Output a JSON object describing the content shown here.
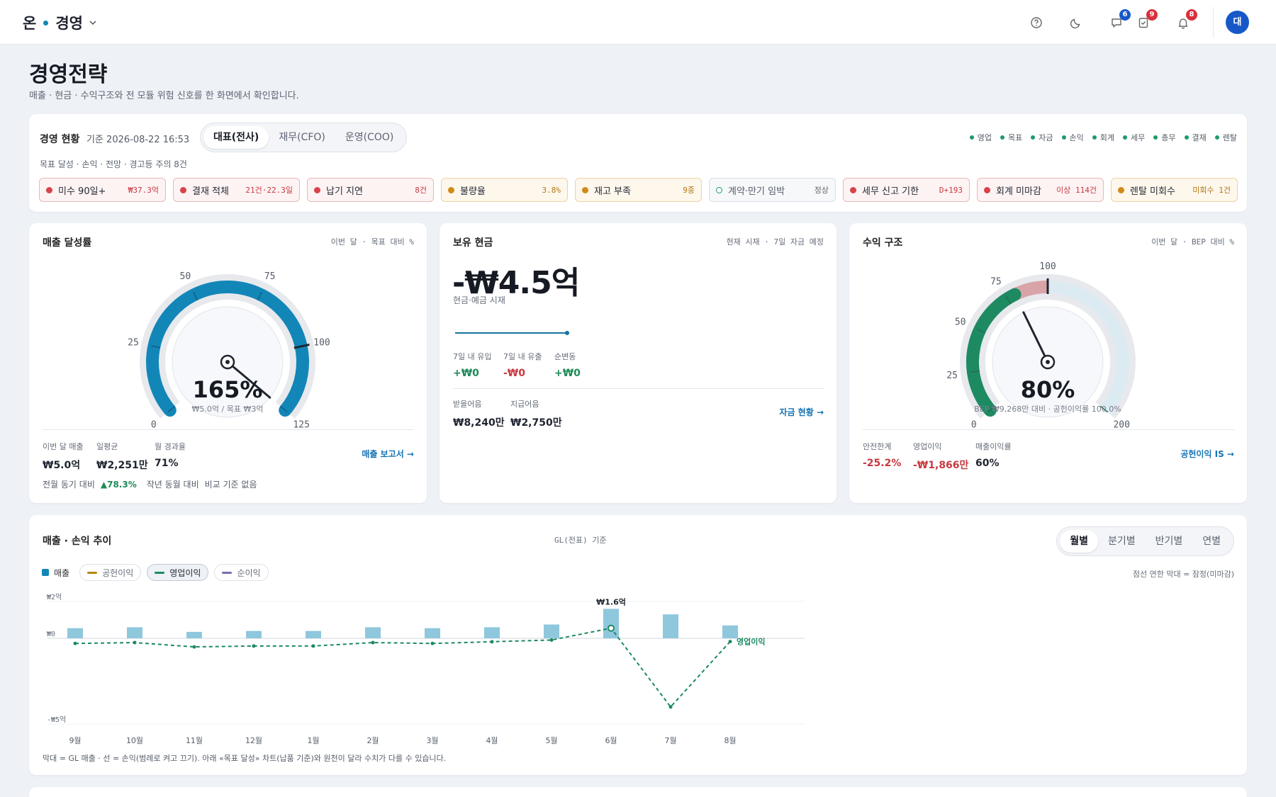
{
  "topbar": {
    "brand": "온",
    "section": "경영",
    "badges": {
      "messages": "6",
      "tasks": "9",
      "notifications": "8"
    },
    "avatar": "대"
  },
  "page": {
    "title": "경영전략",
    "subtitle": "매출 · 현금 · 수익구조와 전 모듈 위험 신호를 한 화면에서 확인합니다."
  },
  "status": {
    "title": "경영 현황",
    "timestamp": "기준 2026-08-22 16:53",
    "views": [
      "대표(전사)",
      "재무(CFO)",
      "운영(COO)"
    ],
    "active_view": "대표(전사)",
    "modules": [
      "영업",
      "목표",
      "자금",
      "손익",
      "회계",
      "세무",
      "총무",
      "결재",
      "렌탈"
    ],
    "summary": "목표 달성 · 손익 · 전망 · 경고등 주의 8건",
    "chips": [
      {
        "label": "미수 90일+",
        "value": "₩37.3억",
        "level": "red"
      },
      {
        "label": "결재 적체",
        "value": "21건·22.3일",
        "level": "red"
      },
      {
        "label": "납기 지연",
        "value": "8건",
        "level": "red"
      },
      {
        "label": "불량율",
        "value": "3.8%",
        "level": "amber"
      },
      {
        "label": "재고 부족",
        "value": "9종",
        "level": "amber"
      },
      {
        "label": "계약·만기 임박",
        "value": "정상",
        "level": "gray"
      },
      {
        "label": "세무 신고 기한",
        "value": "D+193",
        "level": "red"
      },
      {
        "label": "회계 미마감",
        "value": "이상 114건",
        "level": "red"
      },
      {
        "label": "렌탈 미회수",
        "value": "미회수 1건",
        "level": "amber"
      }
    ]
  },
  "revenue": {
    "title": "매출 달성률",
    "note": "이번 달 · 목표 대비 %",
    "gauge": {
      "value": 165,
      "display": "165%",
      "caption": "₩5.0억 / 목표 ₩3억",
      "ticks": [
        "0",
        "25",
        "50",
        "75",
        "100",
        "125"
      ],
      "max": 125,
      "target": 100
    },
    "stats": [
      {
        "label": "이번 달 매출",
        "value": "₩5.0억"
      },
      {
        "label": "일평균",
        "value": "₩2,251만"
      },
      {
        "label": "월 경과율",
        "value": "71%"
      }
    ],
    "link": "매출 보고서 →",
    "yoy": {
      "label": "전월 동기 대비",
      "value": "78.3%",
      "label2": "작년 동월 대비",
      "value2": "비교 기준 없음"
    }
  },
  "cash": {
    "title": "보유 현금",
    "note": "현재 시재 · 7일 자금 예정",
    "big": "-₩4.5억",
    "caption": "현금·예금 시재",
    "stats": [
      {
        "label": "7일 내 유입",
        "value": "+₩0",
        "color": "#1f8a57"
      },
      {
        "label": "7일 내 유출",
        "value": "-₩0",
        "color": "#c73a41"
      },
      {
        "label": "순변동",
        "value": "+₩0",
        "color": "#1f8a57"
      }
    ],
    "stats2": [
      {
        "label": "받을어음",
        "value": "₩8,240만"
      },
      {
        "label": "지급어음",
        "value": "₩2,750만"
      }
    ],
    "link": "자금 현황 →"
  },
  "profit": {
    "title": "수익 구조",
    "note": "이번 달 · BEP 대비 %",
    "gauge": {
      "value": 80,
      "display": "80%",
      "caption": "BEP ₩9,268만 대비 · 공헌이익률 100.0%",
      "ticks": [
        "0",
        "25",
        "50",
        "75",
        "100",
        "200"
      ],
      "max": 200
    },
    "stats": [
      {
        "label": "안전한계",
        "value": "-25.2%",
        "color": "#c73a41"
      },
      {
        "label": "영업이익",
        "value": "-₩1,866만",
        "color": "#c73a41"
      },
      {
        "label": "매출이익률",
        "value": "60%",
        "color": "#1f2430"
      }
    ],
    "link": "공헌이익 IS →"
  },
  "trend": {
    "title": "매출 · 손익 추이",
    "basis": "GL(전표) 기준",
    "periods": [
      "월별",
      "분기별",
      "반기별",
      "연별"
    ],
    "active_period": "월별",
    "legend": [
      "매출",
      "공헌이익",
      "영업이익",
      "순이익"
    ],
    "active_legend": "영업이익",
    "note": "점선 연한 막대 = 잠정(미마감)",
    "footnote": "막대 = GL 매출 · 선 = 손익(범례로 켜고 끄기). 아래 «목표 달성» 차트(납품 기준)와 원천이 달라 수치가 다를 수 있습니다."
  },
  "chart_data": {
    "type": "bar",
    "categories": [
      "9월",
      "10월",
      "11월",
      "12월",
      "1월",
      "2월",
      "3월",
      "4월",
      "5월",
      "6월",
      "7월",
      "8월"
    ],
    "y_tick_labels": [
      "₩2억",
      "₩0",
      "-₩5억"
    ],
    "ylim": [
      -5,
      2
    ],
    "y_unit": "억",
    "series": [
      {
        "name": "매출",
        "type": "bar",
        "values": [
          0.55,
          0.6,
          0.35,
          0.4,
          0.4,
          0.6,
          0.55,
          0.6,
          0.75,
          1.6,
          1.3,
          0.7
        ]
      },
      {
        "name": "영업이익",
        "type": "line",
        "values": [
          -0.3,
          -0.25,
          -0.5,
          -0.45,
          -0.45,
          -0.25,
          -0.3,
          -0.2,
          -0.1,
          0.55,
          -4.0,
          -0.19
        ]
      }
    ],
    "annotations": [
      {
        "category": "6월",
        "text": "₩1.6억"
      },
      {
        "category": "8월",
        "text": "영업이익"
      }
    ]
  }
}
